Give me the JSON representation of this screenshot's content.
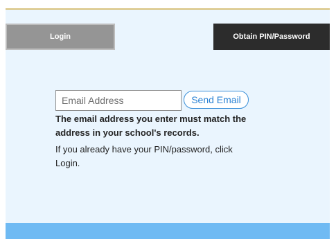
{
  "tabs": {
    "login_label": "Login",
    "pin_label": "Obtain PIN/Password"
  },
  "form": {
    "email_placeholder": "Email Address",
    "email_value": "",
    "send_label": "Send Email"
  },
  "messages": {
    "match_line1": "The email address you enter must match the",
    "match_line2": "address in your school's records.",
    "login_line1": "If you already have your PIN/password, click",
    "login_line2": "Login."
  },
  "colors": {
    "panel_bg": "#eaf5fe",
    "footer_bar": "#6fbaf3",
    "login_tab_bg": "#959595",
    "pin_tab_bg": "#2c2c2c",
    "link_blue": "#2a82d4"
  }
}
